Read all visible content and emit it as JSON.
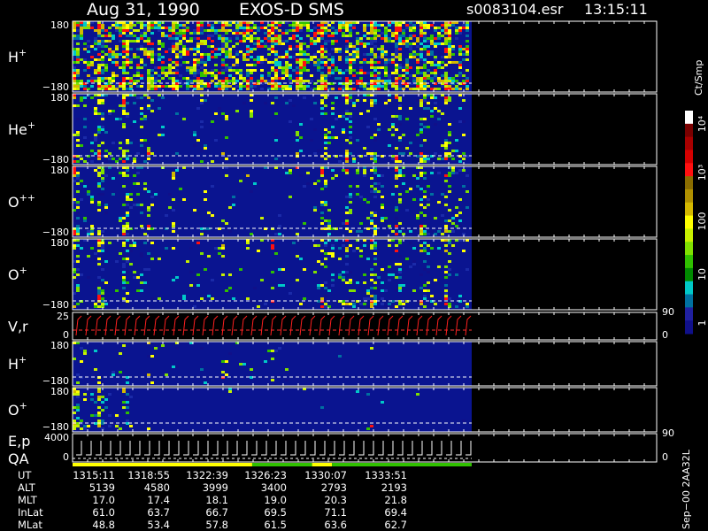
{
  "header": {
    "date": "Aug 31, 1990",
    "instrument": "EXOS-D SMS",
    "file": "s0083104.esr",
    "time": "13:15:11"
  },
  "chart_data": {
    "type": "heatmap",
    "panels": [
      {
        "label": "H",
        "sup": "+",
        "ytop": "180",
        "ybot": "−180"
      },
      {
        "label": "He",
        "sup": "+",
        "ytop": "180",
        "ybot": "−180"
      },
      {
        "label": "O",
        "sup": "++",
        "ytop": "180",
        "ybot": "−180"
      },
      {
        "label": "O",
        "sup": "+",
        "ytop": "180",
        "ybot": "−180"
      },
      {
        "label": "V,r",
        "sup": "",
        "ytop": "25",
        "ybot": "0",
        "right_top": "90",
        "right_bot": "0"
      },
      {
        "label": "H",
        "sup": "+",
        "ytop": "180",
        "ybot": "−180"
      },
      {
        "label": "O",
        "sup": "+",
        "ytop": "180",
        "ybot": "−180"
      },
      {
        "label": "E,p",
        "label2": "QA",
        "sup": "",
        "ytop": "4000",
        "ybot": "0",
        "right_top": "90",
        "right_bot": "0"
      }
    ],
    "colorbar": {
      "title": "Ct/Smp",
      "ticks": [
        "10⁴",
        "10³",
        "100",
        "10",
        "1"
      ],
      "colors": [
        "#ffffff",
        "#7a0000",
        "#a80000",
        "#d40000",
        "#ff1010",
        "#8a6d00",
        "#b09000",
        "#d4b800",
        "#ffff00",
        "#c8f000",
        "#80e000",
        "#30c000",
        "#008a00",
        "#00c8c8",
        "#0070a0",
        "#2020a0",
        "#10108a"
      ]
    },
    "footer_code": "Sep−00 2AA32L"
  },
  "table": {
    "rows": [
      {
        "name": "UT",
        "values": [
          "1315:11",
          "1318:55",
          "1322:39",
          "1326:23",
          "1330:07",
          "1333:51"
        ]
      },
      {
        "name": "ALT",
        "values": [
          "5139",
          "4580",
          "3999",
          "3400",
          "2793",
          "2193"
        ]
      },
      {
        "name": "MLT",
        "values": [
          "17.0",
          "17.4",
          "18.1",
          "19.0",
          "20.3",
          "21.8"
        ]
      },
      {
        "name": "InLat",
        "values": [
          "61.0",
          "63.7",
          "66.7",
          "69.5",
          "71.1",
          "69.4"
        ]
      },
      {
        "name": "MLat",
        "values": [
          "48.8",
          "53.4",
          "57.8",
          "61.5",
          "63.6",
          "62.7"
        ]
      }
    ]
  }
}
